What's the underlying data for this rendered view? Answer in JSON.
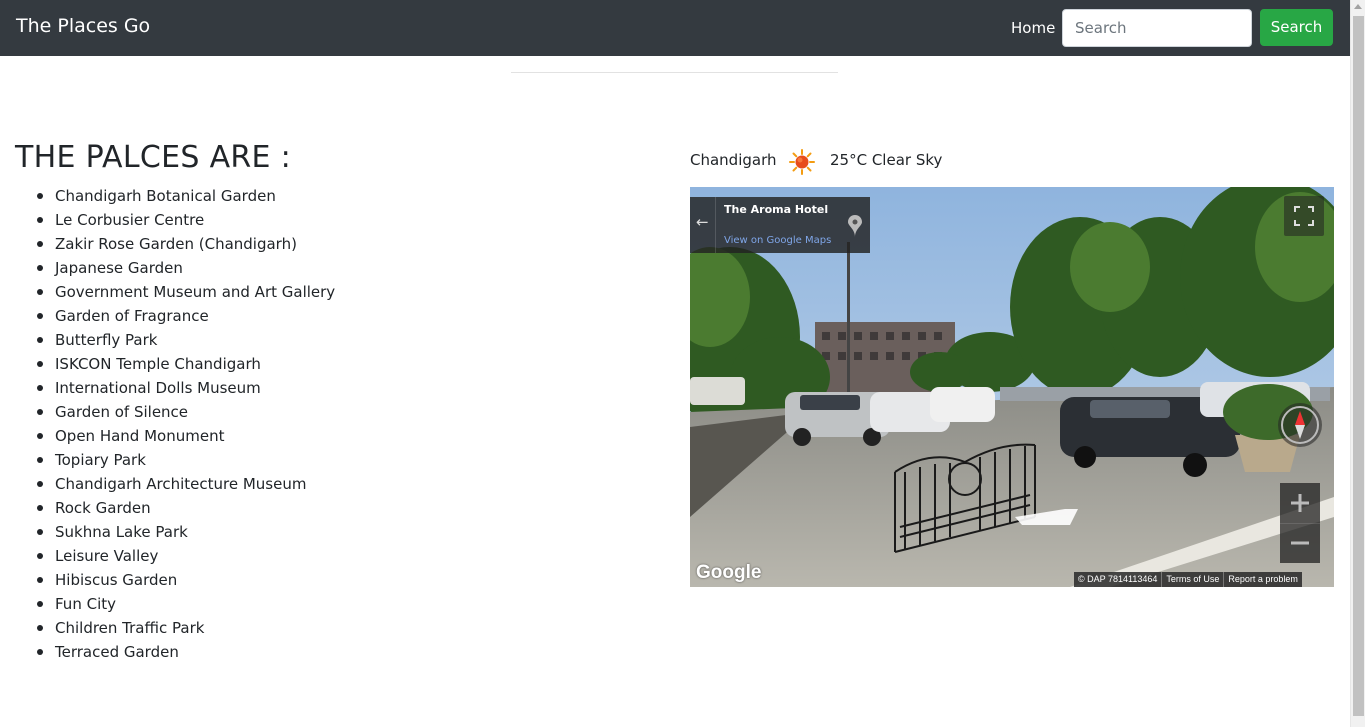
{
  "navbar": {
    "brand": "The Places Go",
    "home_label": "Home",
    "search_placeholder": "Search",
    "search_button": "Search"
  },
  "places": {
    "heading": "THE PALCES ARE :",
    "items": [
      "Chandigarh Botanical Garden",
      "Le Corbusier Centre",
      "Zakir Rose Garden (Chandigarh)",
      "Japanese Garden",
      "Government Museum and Art Gallery",
      "Garden of Fragrance",
      "Butterfly Park",
      "ISKCON Temple Chandigarh",
      "International Dolls Museum",
      "Garden of Silence",
      "Open Hand Monument",
      "Topiary Park",
      "Chandigarh Architecture Museum",
      "Rock Garden",
      "Sukhna Lake Park",
      "Leisure Valley",
      "Hibiscus Garden",
      "Fun City",
      "Children Traffic Park",
      "Terraced Garden"
    ]
  },
  "weather": {
    "city": "Chandigarh",
    "icon": "sun-icon",
    "summary": "25°C Clear Sky"
  },
  "streetview": {
    "place_title": "The Aroma Hotel",
    "view_link": "View on Google Maps",
    "logo": "Google",
    "footer": [
      "© DAP 7814113464",
      "Terms of Use",
      "Report a problem"
    ]
  },
  "colors": {
    "navbar_bg": "#343a40",
    "search_button": "#28a745"
  }
}
